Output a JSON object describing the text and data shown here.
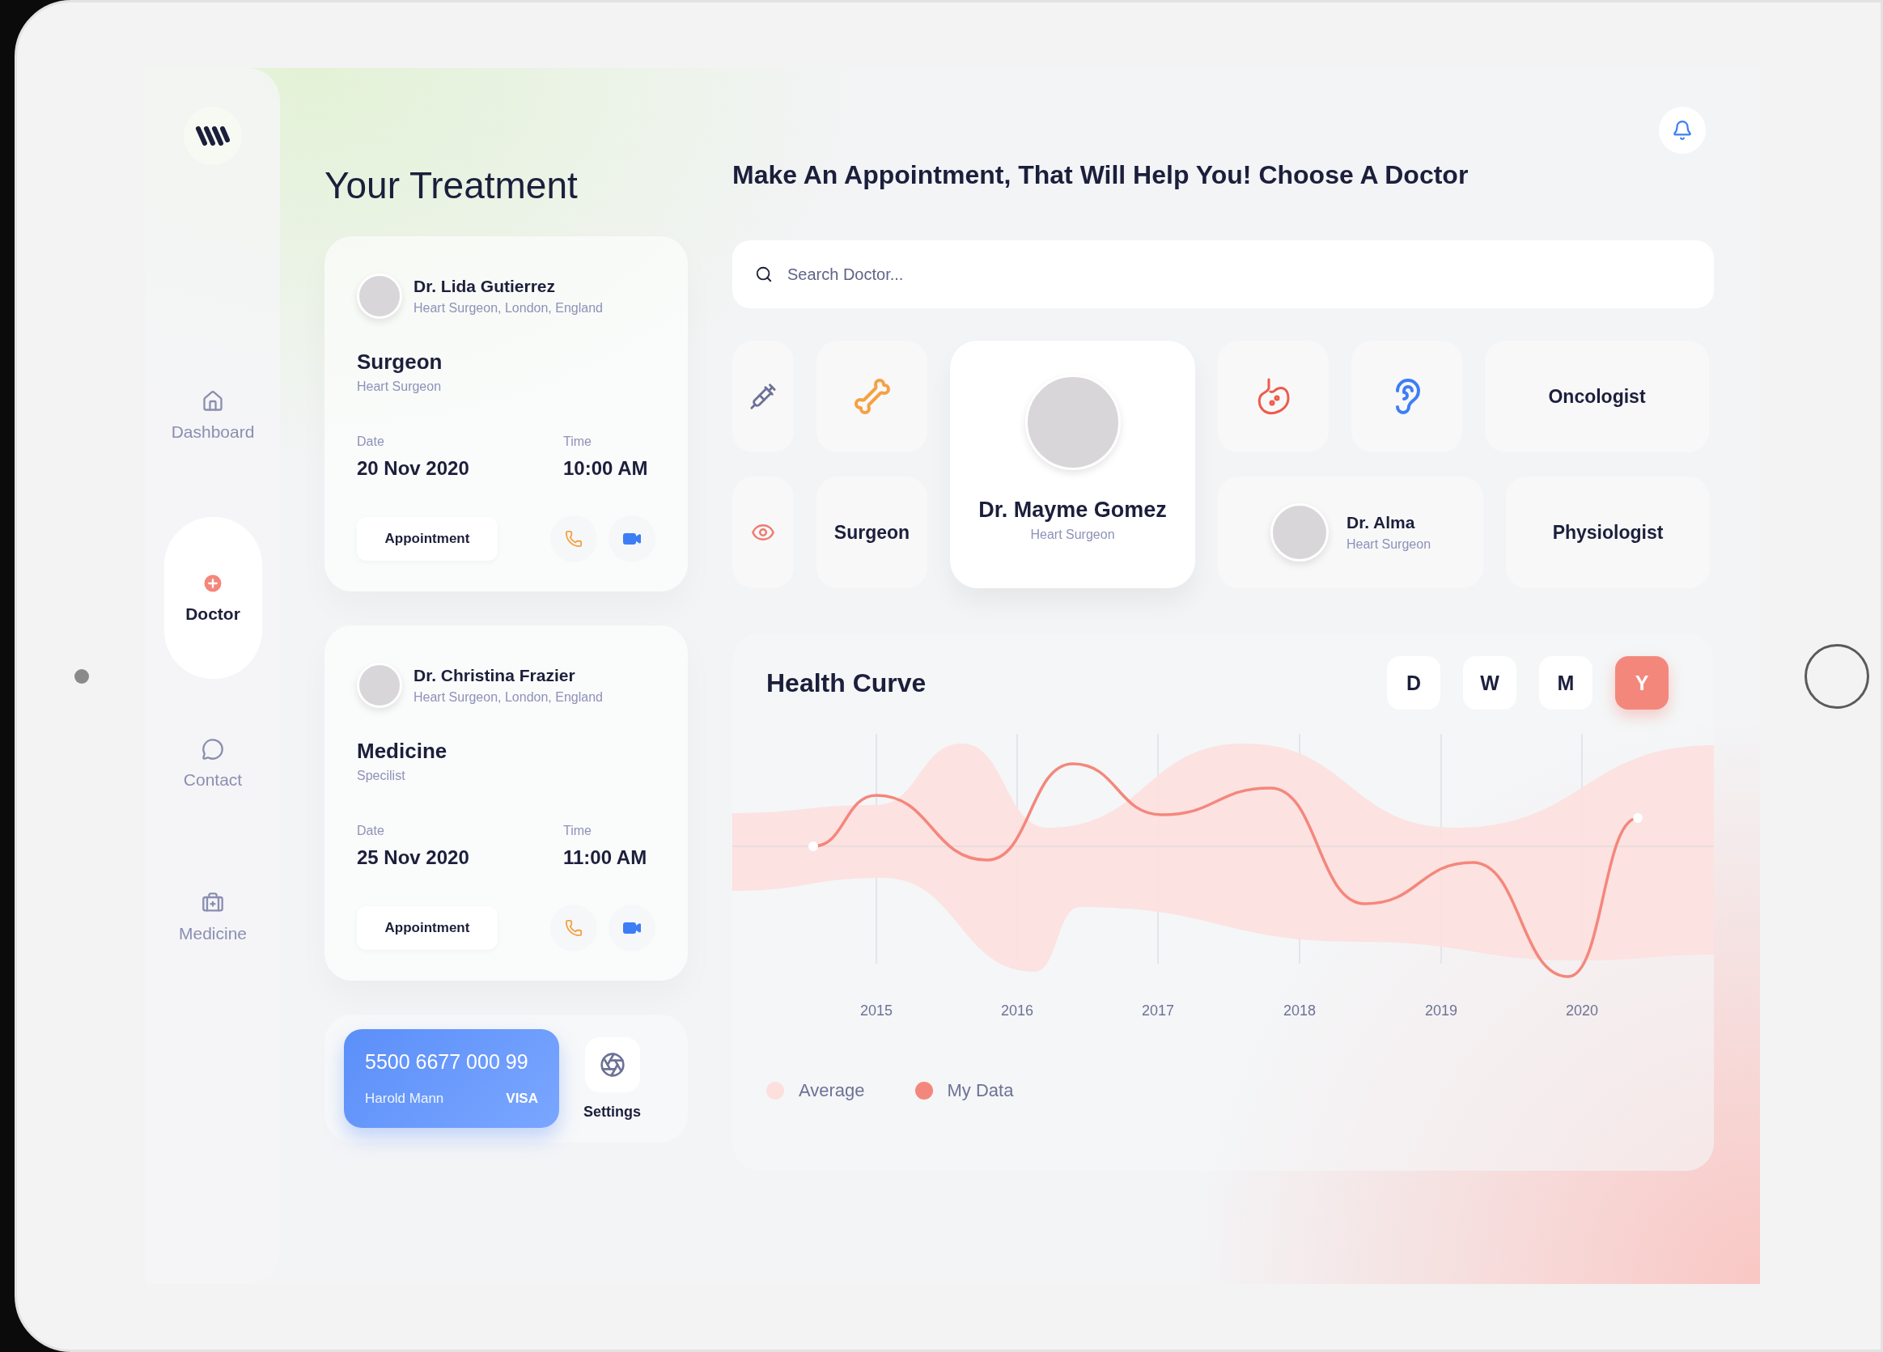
{
  "sidebar": {
    "items": [
      {
        "label": "Dashboard",
        "selected": false
      },
      {
        "label": "Doctor",
        "selected": true
      },
      {
        "label": "Contact",
        "selected": false
      },
      {
        "label": "Medicine",
        "selected": false
      }
    ]
  },
  "treatment": {
    "title": "Your Treatment",
    "cards": [
      {
        "doctor": "Dr. Lida Gutierrez",
        "doctor_info": "Heart Surgeon, London, England",
        "title": "Surgeon",
        "subtitle": "Heart Surgeon",
        "date_label": "Date",
        "date": "20 Nov 2020",
        "time_label": "Time",
        "time": "10:00 AM",
        "button": "Appointment"
      },
      {
        "doctor": "Dr. Christina Frazier",
        "doctor_info": "Heart Surgeon, London, England",
        "title": "Medicine",
        "subtitle": "Specilist",
        "date_label": "Date",
        "date": "25 Nov 2020",
        "time_label": "Time",
        "time": "11:00 AM",
        "button": "Appointment"
      }
    ]
  },
  "payment_card": {
    "number": "5500 6677 000 99",
    "holder": "Harold Mann",
    "brand": "VISA"
  },
  "settings": {
    "label": "Settings"
  },
  "appointment": {
    "title": "Make An Appointment, That Will Help You! Choose A Doctor",
    "search": {
      "placeholder": "Search Doctor..."
    },
    "featured_doctor": {
      "name": "Dr. Mayme Gomez",
      "specialty": "Heart Surgeon"
    },
    "side_doctor": {
      "name": "Dr. Alma",
      "specialty": "Heart Surgeon"
    },
    "specialties": [
      "Surgeon",
      "Oncologist",
      "Physiologist"
    ]
  },
  "health_curve": {
    "title": "Health Curve",
    "periods": [
      {
        "label": "D",
        "selected": false
      },
      {
        "label": "W",
        "selected": false
      },
      {
        "label": "M",
        "selected": false
      },
      {
        "label": "Y",
        "selected": true
      }
    ],
    "x_labels": [
      "2015",
      "2016",
      "2017",
      "2018",
      "2019",
      "2020"
    ],
    "legend": [
      {
        "label": "Average",
        "color": "#fde0de"
      },
      {
        "label": "My Data",
        "color": "#f4877c"
      }
    ]
  }
}
